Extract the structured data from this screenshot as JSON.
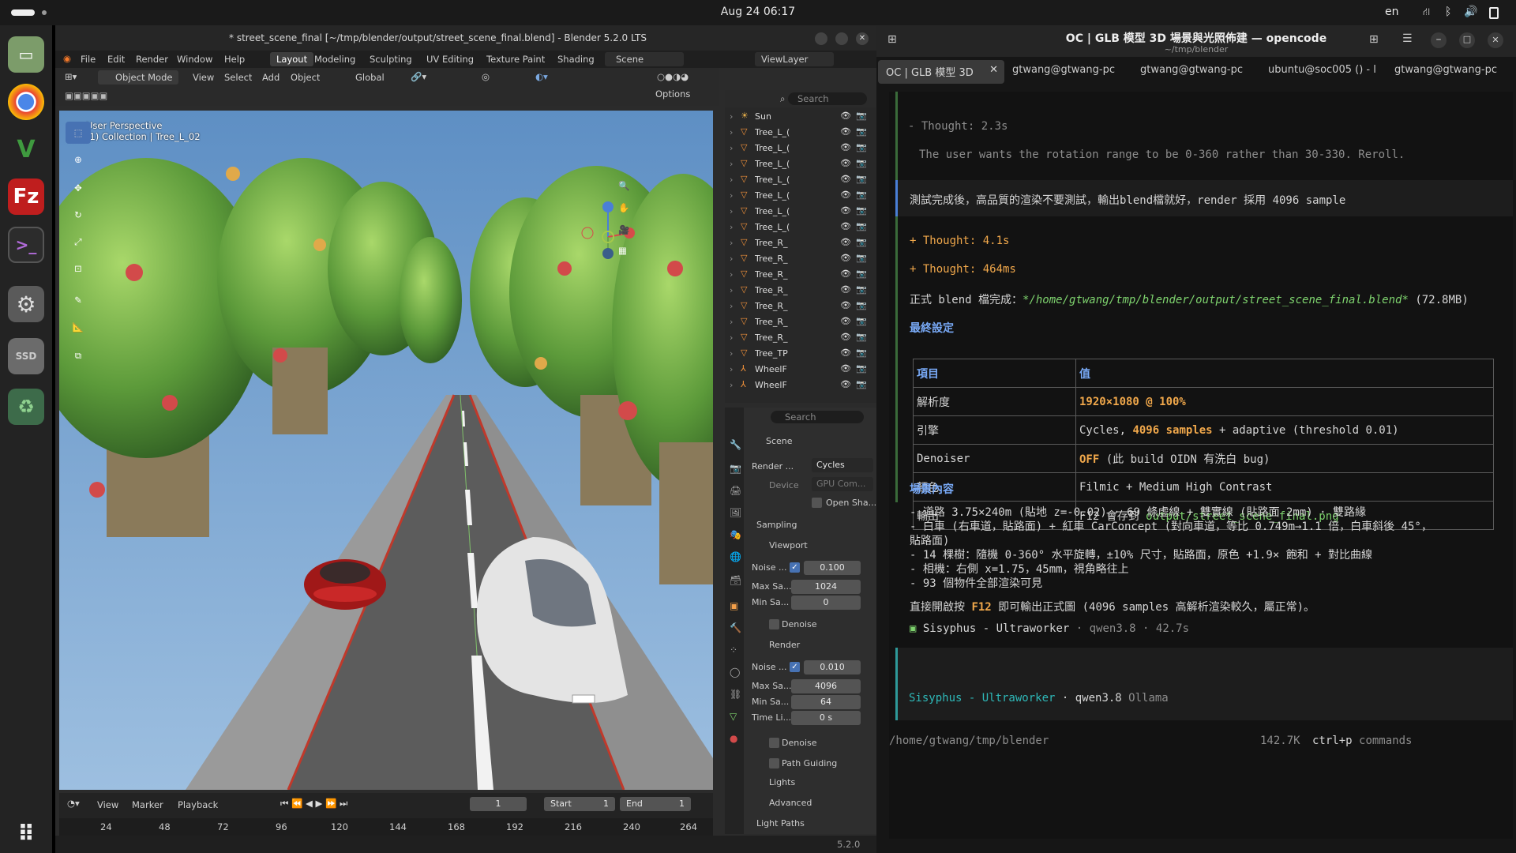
{
  "topbar": {
    "datetime": "Aug 24  06:17",
    "lang": "en"
  },
  "dock": {
    "ssd_label": "SSD"
  },
  "blender": {
    "title": "* street_scene_final [~/tmp/blender/output/street_scene_final.blend] - Blender 5.2.0 LTS",
    "menu": [
      "File",
      "Edit",
      "Render",
      "Window",
      "Help"
    ],
    "workspaces": [
      "Layout",
      "Modeling",
      "Sculpting",
      "UV Editing",
      "Texture Paint",
      "Shading"
    ],
    "scene": "Scene",
    "view_layer": "ViewLayer",
    "header": {
      "mode": "Object Mode",
      "view": "View",
      "select": "Select",
      "add": "Add",
      "object": "Object",
      "orientation": "Global",
      "search_placeholder": "Search",
      "options": "Options"
    },
    "viewport": {
      "perspective": "User Perspective",
      "collection": "(1) Collection | Tree_L_02"
    },
    "outliner": [
      "Sun",
      "Tree_L_(",
      "Tree_L_(",
      "Tree_L_(",
      "Tree_L_(",
      "Tree_L_(",
      "Tree_L_(",
      "Tree_L_(",
      "Tree_R_",
      "Tree_R_",
      "Tree_R_",
      "Tree_R_",
      "Tree_R_",
      "Tree_R_",
      "Tree_R_",
      "Tree_TP",
      "WheelF",
      "WheelF"
    ],
    "props": {
      "search_placeholder": "Search",
      "scene": "Scene",
      "render_label": "Render ...",
      "engine": "Cycles",
      "device_label": "Device",
      "device": "GPU Com...",
      "open_shading": "Open Sha...",
      "sampling": "Sampling",
      "viewport": "Viewport",
      "noise_label": "Noise ...",
      "vp_noise": "0.100",
      "max_label": "Max Sa...",
      "vp_max": "1024",
      "min_label": "Min Sa...",
      "vp_min": "0",
      "denoise": "Denoise",
      "render": "Render",
      "r_noise": "0.010",
      "r_max": "4096",
      "r_min": "64",
      "time_label": "Time Li...",
      "r_time": "0 s",
      "path_guiding": "Path Guiding",
      "lights": "Lights",
      "advanced": "Advanced",
      "light_paths": "Light Paths"
    },
    "timeline": {
      "view": "View",
      "marker": "Marker",
      "playback": "Playback",
      "frame": "1",
      "start_label": "Start",
      "start": "1",
      "end_label": "End",
      "end": "1",
      "ticks": [
        "24",
        "48",
        "72",
        "96",
        "120",
        "144",
        "168",
        "192",
        "216",
        "240",
        "264"
      ]
    },
    "status": {
      "version": "5.2.0"
    }
  },
  "terminal": {
    "title": "OC | GLB 模型 3D 場景與光照佈建 — opencode",
    "subtitle": "~/tmp/blender",
    "tabs": [
      "OC | GLB 模型 3D",
      "gtwang@gtwang-pc",
      "gtwang@gtwang-pc",
      "ubuntu@soc005 () - l",
      "gtwang@gtwang-pc"
    ],
    "thought1": "- Thought: 2.3s",
    "thought1_text": "The user wants the rotation range to be 0-360 rather than 30-330. Reroll.",
    "user_msg": "測試完成後，高品質的渲染不要測試，輸出blend檔就好，render 採用 4096 sample",
    "thought2": "+ Thought: 4.1s",
    "thought3": "+ Thought: 464ms",
    "done_prefix": "正式 blend 檔完成：",
    "done_path": "*/home/gtwang/tmp/blender/output/street_scene_final.blend*",
    "done_size": " (72.8MB)",
    "final_heading": "最終設定",
    "table": {
      "head": [
        "項目",
        "值"
      ],
      "rows": [
        {
          "k": "解析度",
          "v1": "1920×1080 @ 100%",
          "v2": ""
        },
        {
          "k": "引擎",
          "v1": "Cycles, ",
          "v2": "4096 samples",
          "v3": " + adaptive (threshold 0.01)"
        },
        {
          "k": "Denoiser",
          "v1": "OFF",
          "v2": " (此 build OIDN 有洗白 bug)"
        },
        {
          "k": "顏色",
          "v1": "Filmic + Medium High Contrast"
        },
        {
          "k": "輸出",
          "v1": "F12 會存到 ",
          "v2": "output/street_scene_final.png"
        }
      ]
    },
    "content_heading": "場景內容",
    "bullets": [
      "- 道路 3.75×240m (貼地 z=-0.02) · 69 條虛線 + 雙實線 (貼路面 2mm) · 雙路緣",
      "- 白車 (右車道，貼路面) + 紅車 CarConcept (對向車道，等比 0.749m→1.1 倍，白車斜後 45°，",
      "  貼路面)",
      "- 14 棵樹：隨機 0-360° 水平旋轉，±10% 尺寸，貼路面，原色 +1.9× 飽和 + 對比曲線",
      "- 相機：右側 x=1.75，45mm，視角略往上",
      "- 93 個物件全部渲染可見"
    ],
    "f12_pre": "直接開啟按 ",
    "f12_key": "F12",
    "f12_post": " 即可輸出正式圖 (4096 samples 高解析渲染較久，屬正常)。",
    "agent_line": "Sisyphus - Ultraworker",
    "agent_meta": " · qwen3.8 · 42.7s",
    "prompt_agent": "Sisyphus - Ultraworker",
    "prompt_model": " · qwen3.8 ",
    "prompt_provider": "Ollama",
    "cwd": "/home/gtwang/tmp/blender",
    "tokens": "142.7K",
    "shortcut": "ctrl+p",
    "shortcut_label": "commands"
  },
  "colors": {
    "accent": "#4772b3",
    "terminal_green": "#7ed36e",
    "terminal_blue": "#79aaf7",
    "terminal_orange": "#f1a84b"
  }
}
